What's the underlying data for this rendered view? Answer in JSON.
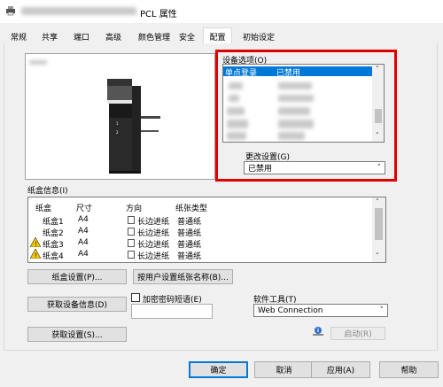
{
  "window": {
    "title_suffix": "PCL 属性"
  },
  "tabs": [
    "常规",
    "共享",
    "端口",
    "高级",
    "颜色管理",
    "安全",
    "配置",
    "初始设定"
  ],
  "device_options": {
    "label": "设备选项(O)",
    "selected_item": "单点登录",
    "selected_value": "已禁用"
  },
  "change_setting": {
    "label": "更改设置(G)",
    "value": "已禁用"
  },
  "tray_info": {
    "label": "纸盒信息(I)",
    "columns": [
      "纸盒",
      "尺寸",
      "方向",
      "纸张类型"
    ],
    "rows": [
      {
        "tray": "纸盒1",
        "size": "A4",
        "orientation": "长边进纸",
        "type": "普通纸",
        "warning": false
      },
      {
        "tray": "纸盒2",
        "size": "A4",
        "orientation": "长边进纸",
        "type": "普通纸",
        "warning": false
      },
      {
        "tray": "纸盒3",
        "size": "A4",
        "orientation": "长边进纸",
        "type": "普通纸",
        "warning": true
      },
      {
        "tray": "纸盒4",
        "size": "A4",
        "orientation": "长边进纸",
        "type": "普通纸",
        "warning": true
      }
    ]
  },
  "buttons": {
    "tray_settings": "纸盒设置(P)...",
    "user_paper_names": "按用户设置纸张名称(B)...",
    "get_device_info": "获取设备信息(D)",
    "get_settings": "获取设置(S)...",
    "start": "启动(R)",
    "ok": "确定",
    "cancel": "取消",
    "apply": "应用(A)",
    "help": "帮助"
  },
  "encrypt": {
    "label": "加密密码短语(E)",
    "checked": false,
    "value": ""
  },
  "software_tools": {
    "label": "软件工具(T)",
    "value": "Web Connection"
  },
  "icons": {
    "printer": "printer-icon",
    "warning": "warning-icon",
    "info": "info-icon"
  },
  "colors": {
    "selection": "#0078d7",
    "highlight": "#e00000"
  }
}
